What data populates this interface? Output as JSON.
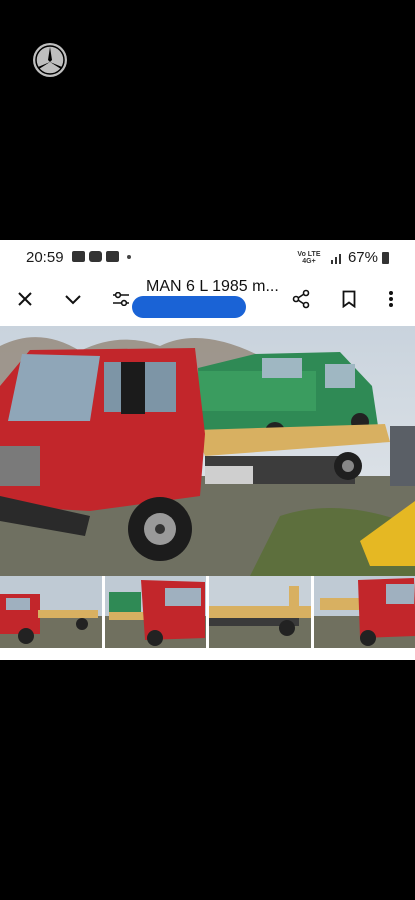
{
  "status_bar": {
    "time": "20:59",
    "network": "Vo LTE 4G+",
    "battery": "67%"
  },
  "toolbar": {
    "title": "MAN 6 L 1985 m..."
  },
  "icons": {
    "logo": "mercedes-star-icon",
    "close": "close-icon",
    "collapse": "chevron-down-icon",
    "filter": "tune-icon",
    "share": "share-icon",
    "bookmark": "bookmark-icon",
    "more": "more-vert-icon"
  },
  "colors": {
    "redaction": "#1a63d6",
    "truck_cab": "#c2262b",
    "car_green": "#2f8a55",
    "platform": "#d8b061"
  }
}
